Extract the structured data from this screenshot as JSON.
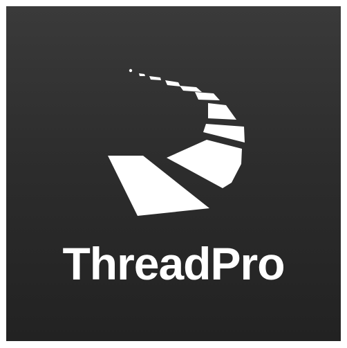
{
  "app": {
    "name": "ThreadPro",
    "icon_name": "threadpro-road-logo-icon"
  },
  "colors": {
    "background_top": "#3a3a3a",
    "background_bottom": "#222222",
    "foreground": "#ffffff"
  }
}
